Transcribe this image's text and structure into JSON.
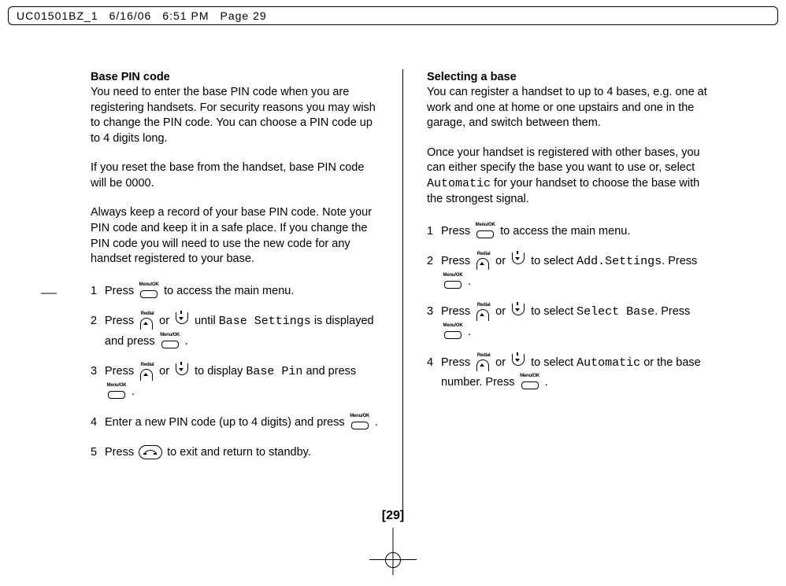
{
  "header": {
    "filename": "UC01501BZ_1",
    "date": "6/16/06",
    "time": "6:51 PM",
    "page": "Page 29"
  },
  "left": {
    "heading": "Base PIN code",
    "p1": "You need to enter the base PIN code when you are registering handsets. For security reasons you may wish to change the PIN code. You can choose a PIN code up to 4 digits long.",
    "p2": "If you reset the base from the handset, base PIN code will be 0000.",
    "p3": "Always keep a record of your base PIN code. Note your PIN code and keep it in a safe place. If you change the PIN code you will need to use the new code for any handset registered to your base.",
    "s1": "Press",
    "s1b": "to access the main menu.",
    "s2": "Press",
    "s2m": "or",
    "s2c": "until",
    "s2lcd": "Base Settings",
    "s2d": "is displayed and press",
    "s3": "Press",
    "s3m": "or",
    "s3c": "to display",
    "s3lcd": "Base Pin",
    "s3d": "and press",
    "s4": "Enter a new PIN code (up to 4 digits) and press",
    "s5": "Press",
    "s5b": "to exit and return to standby."
  },
  "right": {
    "heading": "Selecting a base",
    "p1": "You can register a handset to up to 4 bases, e.g. one at work and one at home or one upstairs and one in the garage, and switch between them.",
    "p2a": "Once your handset is registered with other bases, you can either specify the base you want to use or, select",
    "p2lcd": "Automatic",
    "p2b": "for your handset to choose the base with the strongest signal.",
    "s1": "Press",
    "s1b": "to access the main menu.",
    "s2": "Press",
    "s2m": "or",
    "s2c": "to select",
    "s2lcd": "Add.Settings",
    "s2d": ". Press",
    "s3": "Press",
    "s3m": "or",
    "s3c": "to select",
    "s3lcd": "Select Base",
    "s3d": ". Press",
    "s4": "Press",
    "s4m": "or",
    "s4c": "to select",
    "s4lcd": "Automatic",
    "s4d": "or the base number. Press"
  },
  "pagenum": "[29]"
}
